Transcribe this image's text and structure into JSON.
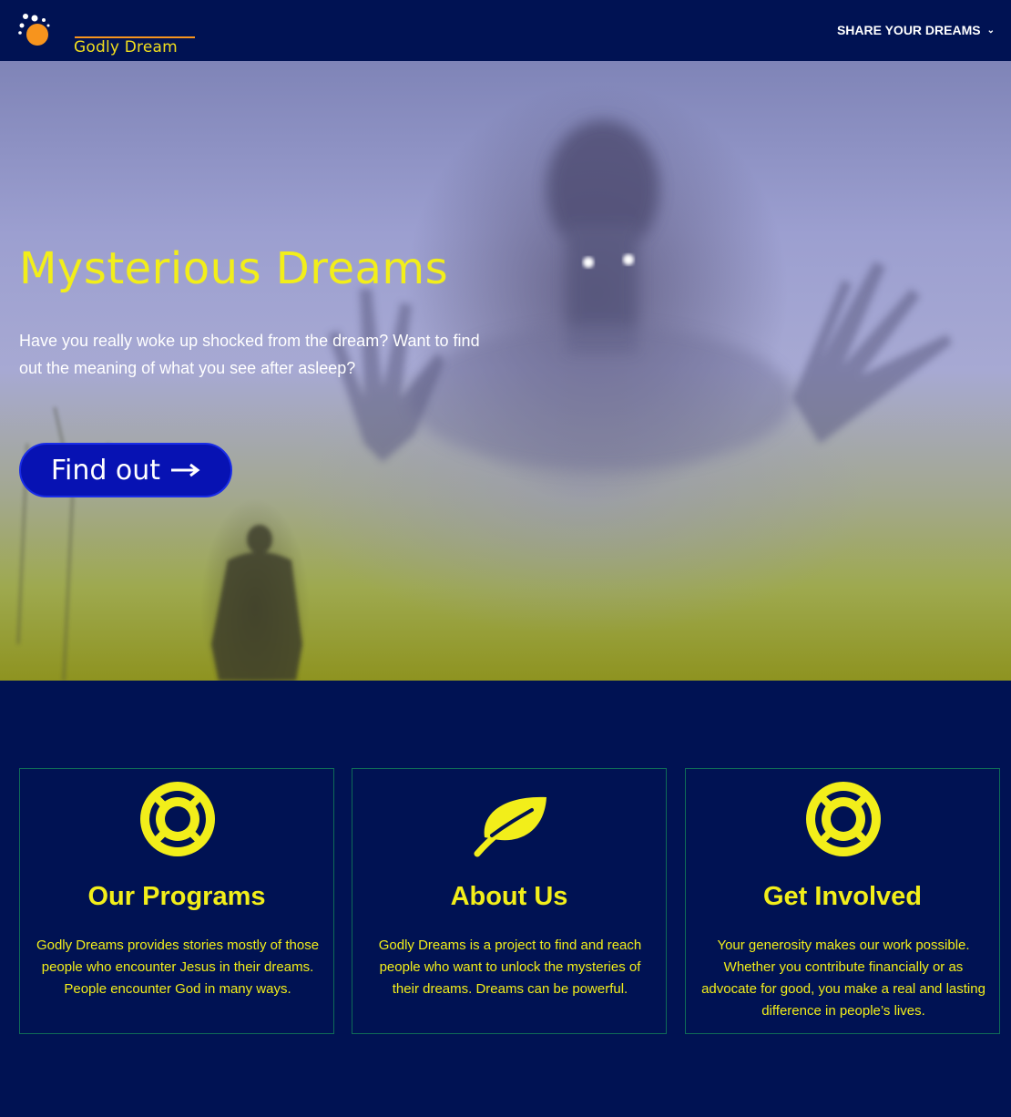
{
  "header": {
    "logo_text": "Godly Dream",
    "nav_label": "SHARE YOUR DREAMS",
    "nav_chevron": "⌄"
  },
  "hero": {
    "title": "Mysterious Dreams",
    "subtitle": "Have you really woke up shocked from the dream? Want to find out the meaning of what you see after asleep?",
    "button_label": "Find out"
  },
  "cards": [
    {
      "icon": "lifebuoy-icon",
      "title": "Our Programs",
      "text": "Godly Dreams provides stories mostly of those people who encounter Jesus in their dreams. People encounter God in many ways."
    },
    {
      "icon": "leaf-icon",
      "title": "About Us",
      "text": "Godly Dreams is a project to find and reach people who want to unlock the mysteries of their dreams. Dreams can be powerful."
    },
    {
      "icon": "lifebuoy-icon",
      "title": "Get Involved",
      "text": "Your generosity makes our work possible. Whether you contribute financially or as advocate for good, you make a real and lasting difference in people’s lives."
    }
  ],
  "colors": {
    "navy": "#001253",
    "accent_yellow": "#f2ee1a",
    "button_blue": "#0712b3",
    "logo_orange": "#f7941d"
  }
}
